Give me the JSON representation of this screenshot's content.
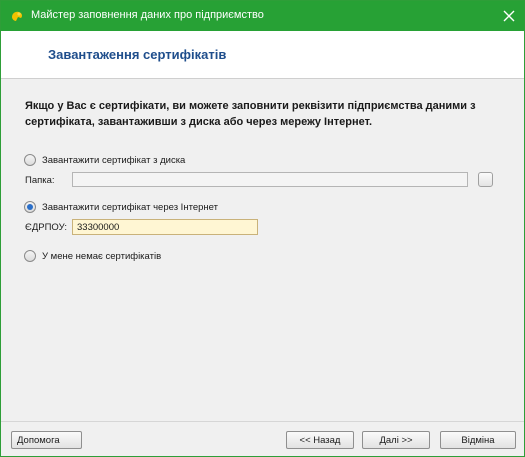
{
  "window": {
    "title": "Майстер заповнення даних про підприємство"
  },
  "header": {
    "title": "Завантаження сертифікатів"
  },
  "intro": {
    "text": "Якщо у Вас є сертифікати, ви можете заповнити реквізити підприємства даними з сертифіката, завантаживши з диска або через мережу Інтернет."
  },
  "options": {
    "from_disk": {
      "label": "Завантажити сертифікат з диска",
      "checked": false
    },
    "folder": {
      "label": "Папка:",
      "value": ""
    },
    "via_internet": {
      "label": "Завантажити сертифікат через Інтернет",
      "checked": true
    },
    "edrpou": {
      "label": "ЄДРПОУ:",
      "value": "33300000"
    },
    "no_certificates": {
      "label": "У мене немає сертифікатів",
      "checked": false
    }
  },
  "buttons": {
    "help": "Допомога",
    "back": "<< Назад",
    "next": "Далі >>",
    "cancel": "Відміна"
  },
  "colors": {
    "titlebar": "#27a135",
    "heading": "#1f4e8c",
    "edrpou_field_bg": "#fff6d3",
    "radio_selected": "#2a6fc9"
  },
  "icons": {
    "app": "yellow-app-icon",
    "close": "close-icon",
    "browse": "browse-folder-icon"
  }
}
